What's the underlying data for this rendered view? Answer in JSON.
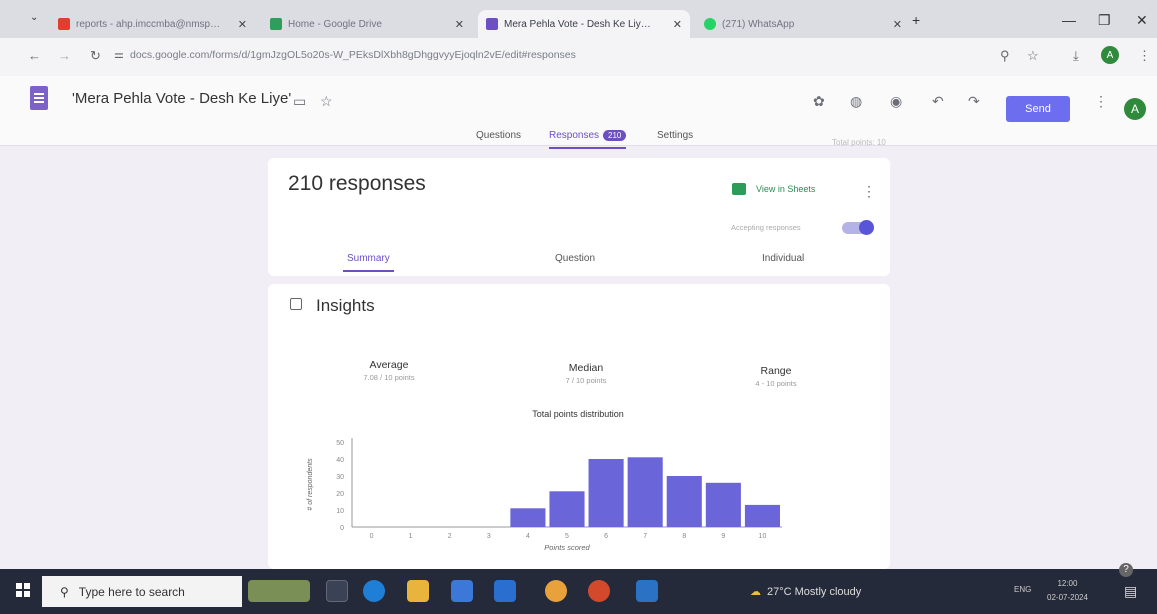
{
  "browser": {
    "tabs": [
      {
        "label": "reports - ahp.imccmba@nmsp…",
        "color": "#e33d2f"
      },
      {
        "label": "Home - Google Drive",
        "color": "#2f9e5a"
      },
      {
        "label": "Mera Pehla Vote - Desh Ke Liy…",
        "color": "#6d4fc4"
      },
      {
        "label": "(271) WhatsApp",
        "color": "#25d366"
      }
    ],
    "new_tab": "+",
    "url": "docs.google.com/forms/d/1gmJzgOL5o20s-W_PEksDlXbh8gDhggvyyEjoqln2vE/edit#responses"
  },
  "form": {
    "title": "'Mera Pehla Vote - Desh Ke Liye'",
    "send_label": "Send",
    "avatar_letter": "A",
    "tabs": {
      "questions": "Questions",
      "responses": "Responses",
      "responses_badge": "210",
      "settings": "Settings"
    },
    "total_points": "Total points: 10"
  },
  "responses": {
    "count_label": "210 responses",
    "view_in_sheets": "View in Sheets",
    "accepting": "Accepting responses",
    "subtabs": [
      "Summary",
      "Question",
      "Individual"
    ]
  },
  "insights": {
    "title": "Insights",
    "average_label": "Average",
    "average_value": "7.08 / 10 points",
    "median_label": "Median",
    "median_value": "7 / 10 points",
    "range_label": "Range",
    "range_value": "4 - 10 points"
  },
  "chart_data": {
    "type": "bar",
    "title": "Total points distribution",
    "xlabel": "Points scored",
    "ylabel": "# of respondents",
    "categories": [
      "0",
      "1",
      "2",
      "3",
      "4",
      "5",
      "6",
      "7",
      "8",
      "9",
      "10"
    ],
    "values": [
      0,
      0,
      0,
      0,
      11,
      21,
      40,
      41,
      30,
      26,
      13
    ],
    "ylim": [
      0,
      50
    ],
    "yticks": [
      0,
      10,
      20,
      30,
      40,
      50
    ],
    "bar_color": "#6a65d8"
  },
  "taskbar": {
    "search_placeholder": "Type here to search",
    "weather": "27°C  Mostly cloudy",
    "lang": "ENG",
    "time": "12:00",
    "date": "02-07-2024"
  }
}
